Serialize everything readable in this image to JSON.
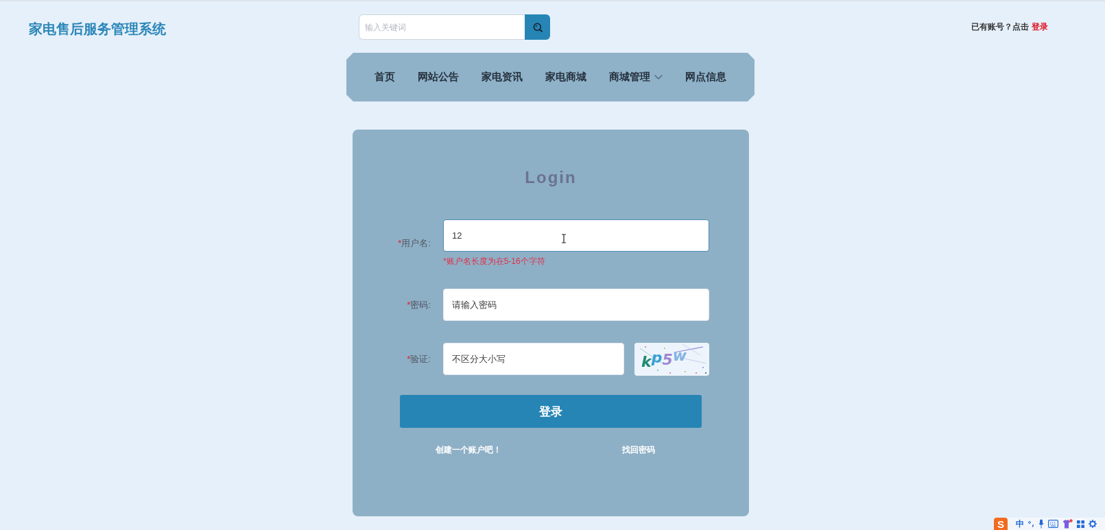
{
  "header": {
    "title": "家电售后服务管理系统",
    "search": {
      "placeholder": "输入关键词"
    },
    "account_prompt": {
      "text": "已有账号？点击",
      "link": "登录"
    }
  },
  "nav": {
    "items": [
      {
        "label": "首页",
        "kind": "link"
      },
      {
        "label": "网站公告",
        "kind": "link"
      },
      {
        "label": "家电资讯",
        "kind": "link"
      },
      {
        "label": "家电商城",
        "kind": "link"
      },
      {
        "label": "商城管理",
        "kind": "dropdown"
      },
      {
        "label": "网点信息",
        "kind": "link"
      }
    ]
  },
  "login_form": {
    "title": "Login",
    "fields": [
      {
        "kind": "text",
        "required_mark": "*",
        "label": "用户名:",
        "value": "12",
        "focused": true,
        "error": "*账户名长度为在5-16个字符"
      },
      {
        "kind": "password",
        "required_mark": "*",
        "label": "密码:",
        "placeholder": "请输入密码",
        "focused": false
      },
      {
        "kind": "captcha",
        "required_mark": "*",
        "label": "验证:",
        "placeholder": "不区分大小写",
        "focused": false,
        "captcha_text": "kp5w"
      }
    ],
    "submit": "登录",
    "links": [
      "创建一个账户吧！",
      "找回密码"
    ]
  },
  "ime_toolbar": {
    "logo": "S",
    "mode": "中"
  }
}
